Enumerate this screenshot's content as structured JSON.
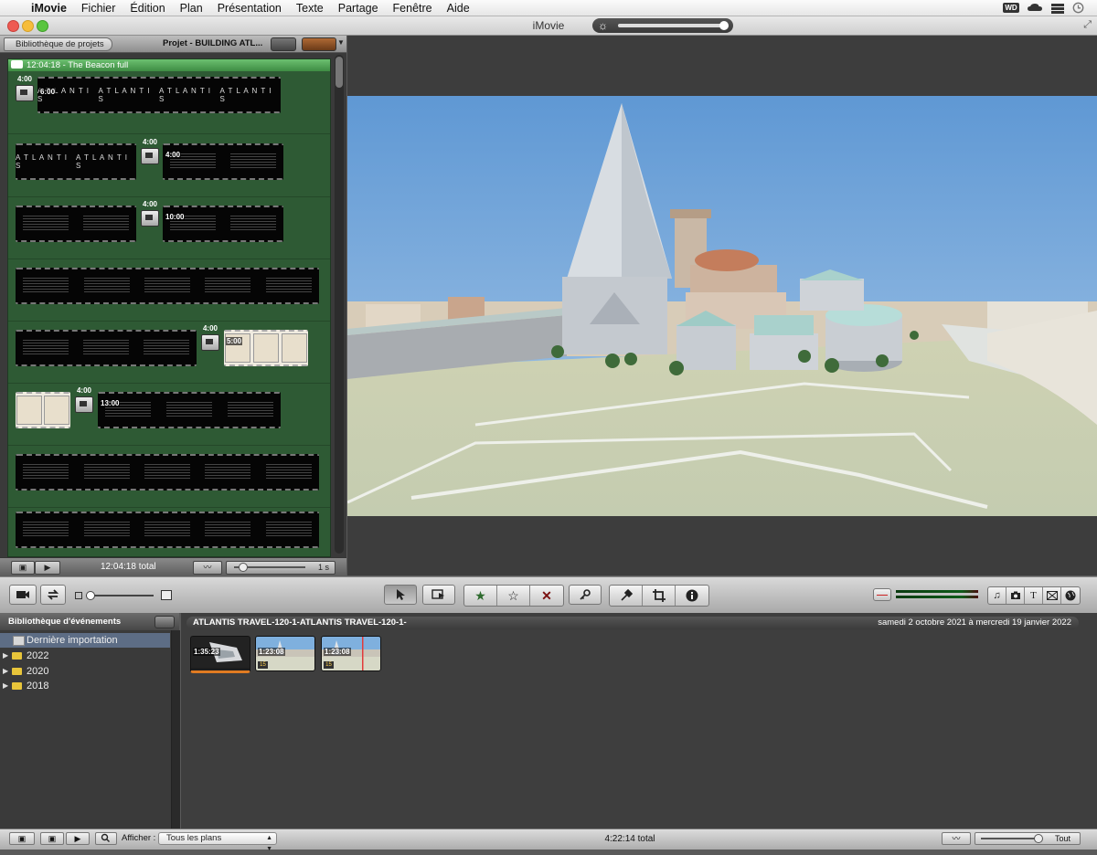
{
  "menubar": {
    "apple": "",
    "app_name": "iMovie",
    "items": [
      "Fichier",
      "Édition",
      "Plan",
      "Présentation",
      "Texte",
      "Partage",
      "Fenêtre",
      "Aide"
    ],
    "status_icons": [
      "wd-icon",
      "cloud-icon",
      "stack-icon",
      "time-machine-icon"
    ],
    "wd_label": "WD"
  },
  "window": {
    "title": "iMovie",
    "brightness_icon": "☼"
  },
  "project": {
    "library_button": "Bibliothèque de projets",
    "title": "Projet - BUILDING ATL...",
    "clip_bar_label": "12:04:18 - The Beacon full",
    "strip_text": "A T L A N T I S",
    "transition_durations": [
      "4:00",
      "4:00",
      "4:00",
      "4:00",
      "4:00"
    ],
    "clip_durations": [
      "6:00",
      "4:00",
      "10:00",
      "5:00",
      "13:00"
    ],
    "total": "12:04:18 total",
    "interval": "1 s"
  },
  "toolbar": {
    "colors": {
      "accent": "#3e8c43",
      "selection": "#5d6d85"
    }
  },
  "events": {
    "library_title": "Bibliothèque d'événements",
    "items": [
      {
        "label": "Dernière importation",
        "selected": true
      },
      {
        "label": "2022",
        "selected": false
      },
      {
        "label": "2020",
        "selected": false
      },
      {
        "label": "2018",
        "selected": false
      }
    ],
    "event_title": "ATLANTIS TRAVEL-120-1-ATLANTIS TRAVEL-120-1-",
    "date_range": "samedi 2 octobre 2021 à mercredi 19 janvier 2022",
    "clips": [
      {
        "duration": "1:35:23"
      },
      {
        "duration": "1:23:08",
        "fps": "15"
      },
      {
        "duration": "1:23:08",
        "fps": "15"
      }
    ]
  },
  "bottom": {
    "filter_label": "Afficher :",
    "filter_value": "Tous les plans",
    "total": "4:22:14 total",
    "zoom_all": "Tout"
  }
}
